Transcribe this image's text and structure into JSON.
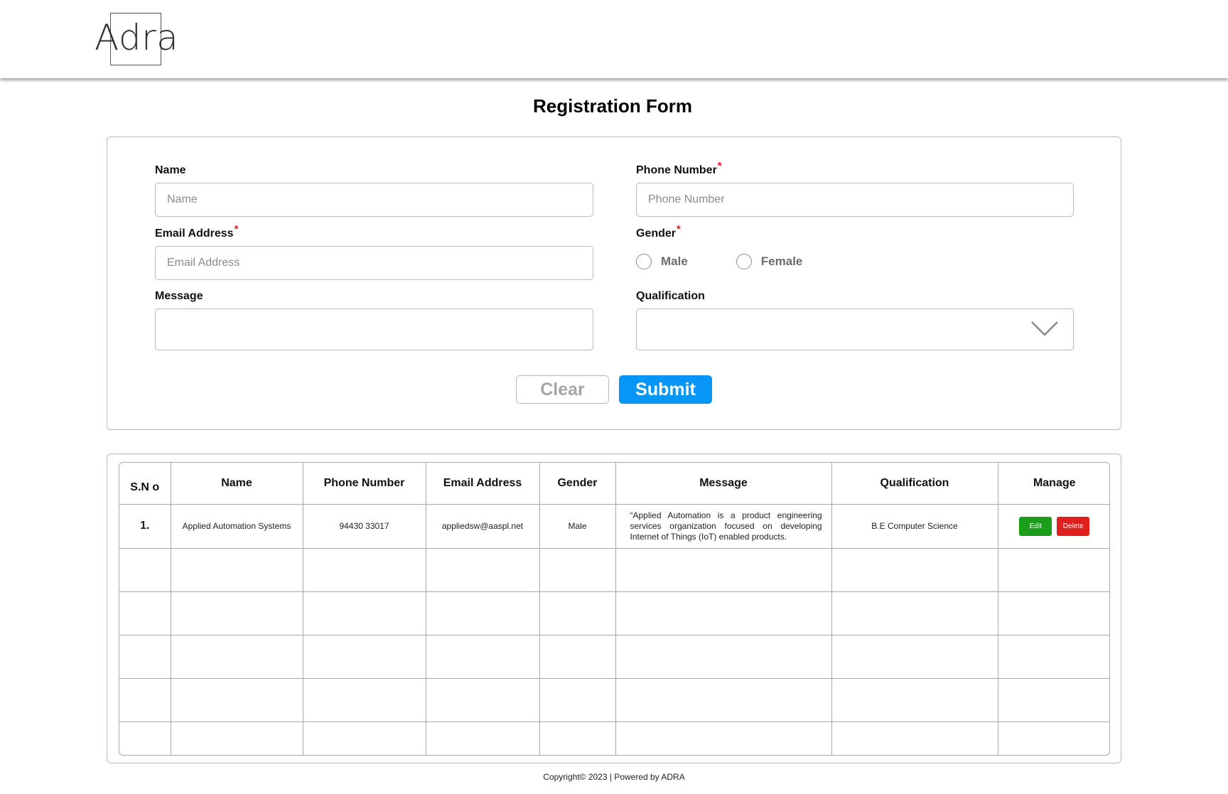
{
  "brand": {
    "logo_text": "Adra"
  },
  "page": {
    "title": "Registration Form"
  },
  "form": {
    "name": {
      "label": "Name",
      "placeholder": "Name",
      "value": ""
    },
    "phone": {
      "label": "Phone Number",
      "required_mark": "*",
      "placeholder": "Phone Number",
      "value": ""
    },
    "email": {
      "label": "Email Address",
      "required_mark": "*",
      "placeholder": "Email Address",
      "value": ""
    },
    "gender": {
      "label": "Gender",
      "required_mark": "*",
      "options": [
        "Male",
        "Female"
      ],
      "selected": null
    },
    "message": {
      "label": "Message",
      "value": ""
    },
    "qualification": {
      "label": "Qualification",
      "selected": ""
    },
    "buttons": {
      "clear": "Clear",
      "submit": "Submit"
    }
  },
  "table": {
    "headers": [
      "S.N o",
      "Name",
      "Phone Number",
      "Email Address",
      "Gender",
      "Message",
      "Qualification",
      "Manage"
    ],
    "rows": [
      {
        "sno": "1.",
        "name": "Applied Automation Systems",
        "phone": "94430 33017",
        "email": "appliedsw@aaspl.net",
        "gender": "Male",
        "message": "“Applied Automation is a product engineering services organization focused on developing Internet of Things (IoT) enabled products.",
        "qualification": "B.E Computer Science",
        "actions": {
          "edit": "Edit",
          "delete": "Delete"
        }
      }
    ]
  },
  "colors": {
    "primary": "#0896f6",
    "edit": "#1c9d1a",
    "delete": "#e0201f",
    "required": "#e01b1b"
  },
  "footer": {
    "text": "Copyright© 2023 | Powered by ADRA"
  }
}
